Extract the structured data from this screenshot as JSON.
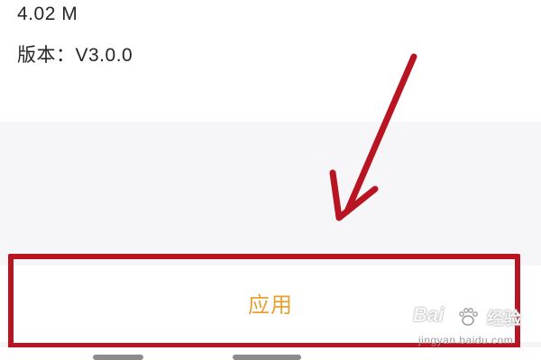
{
  "app_info": {
    "size": "4.02 M",
    "version": "版本：V3.0.0"
  },
  "apply_bar": {
    "label": "应用"
  },
  "annotation": {
    "arrow_color": "#b81422",
    "highlight_color": "#b81422"
  },
  "watermark": {
    "brand": "Bai",
    "sub": "经验",
    "domain": "jingyan.baidu.com",
    "icon": "paw-icon"
  },
  "colors": {
    "apply_text": "#e8a130",
    "background": "#f6f5f8"
  }
}
